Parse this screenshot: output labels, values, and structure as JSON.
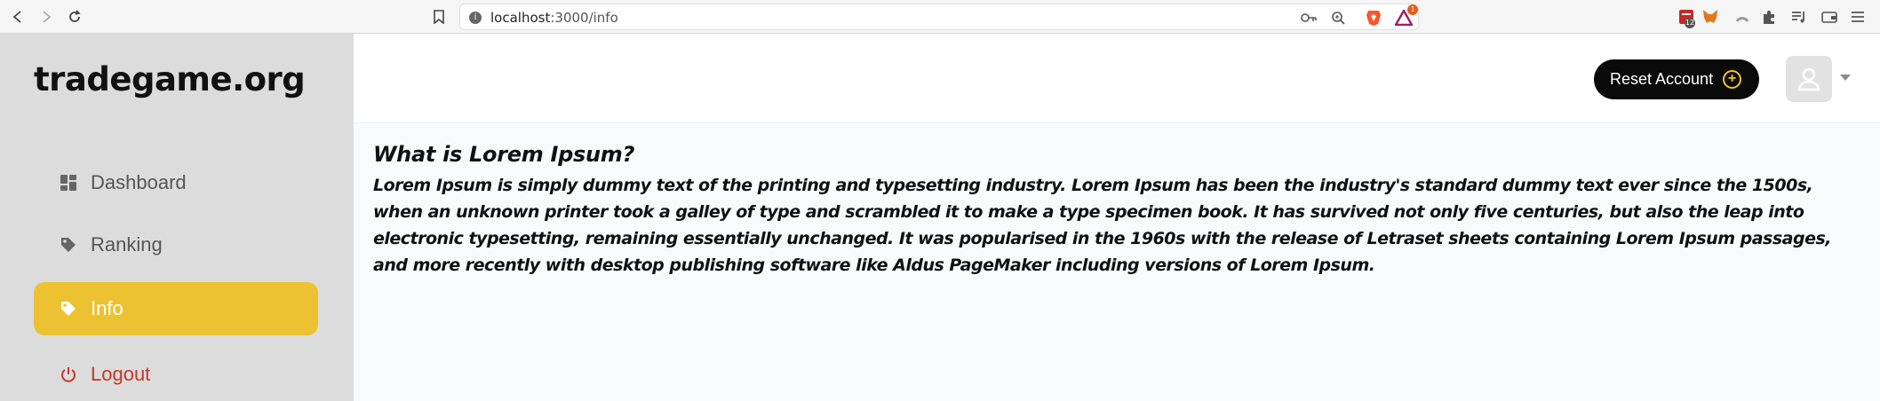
{
  "browser": {
    "url_host": "localhost",
    "url_path": ":3000/info",
    "ext_badge_count": "12",
    "bat_badge": "1"
  },
  "sidebar": {
    "brand": "tradegame.org",
    "items": [
      {
        "label": "Dashboard",
        "icon": "dashboard-icon"
      },
      {
        "label": "Ranking",
        "icon": "tag-icon"
      },
      {
        "label": "Info",
        "icon": "tag-icon",
        "active": true
      },
      {
        "label": "Logout",
        "icon": "power-icon"
      }
    ]
  },
  "header": {
    "reset_label": "Reset Account"
  },
  "main": {
    "title": "What is Lorem Ipsum?",
    "body": "Lorem Ipsum is simply dummy text of the printing and typesetting industry. Lorem Ipsum has been the industry's standard dummy text ever since the 1500s, when an unknown printer took a galley of type and scrambled it to make a type specimen book. It has survived not only five centuries, but also the leap into electronic typesetting, remaining essentially unchanged. It was popularised in the 1960s with the release of Letraset sheets containing Lorem Ipsum passages, and more recently with desktop publishing software like Aldus PageMaker including versions of Lorem Ipsum."
  },
  "colors": {
    "accent": "#ecc233",
    "sidebar_bg": "#dcdcdc",
    "logout": "#c0392b",
    "button_bg": "#0a0a0a"
  }
}
